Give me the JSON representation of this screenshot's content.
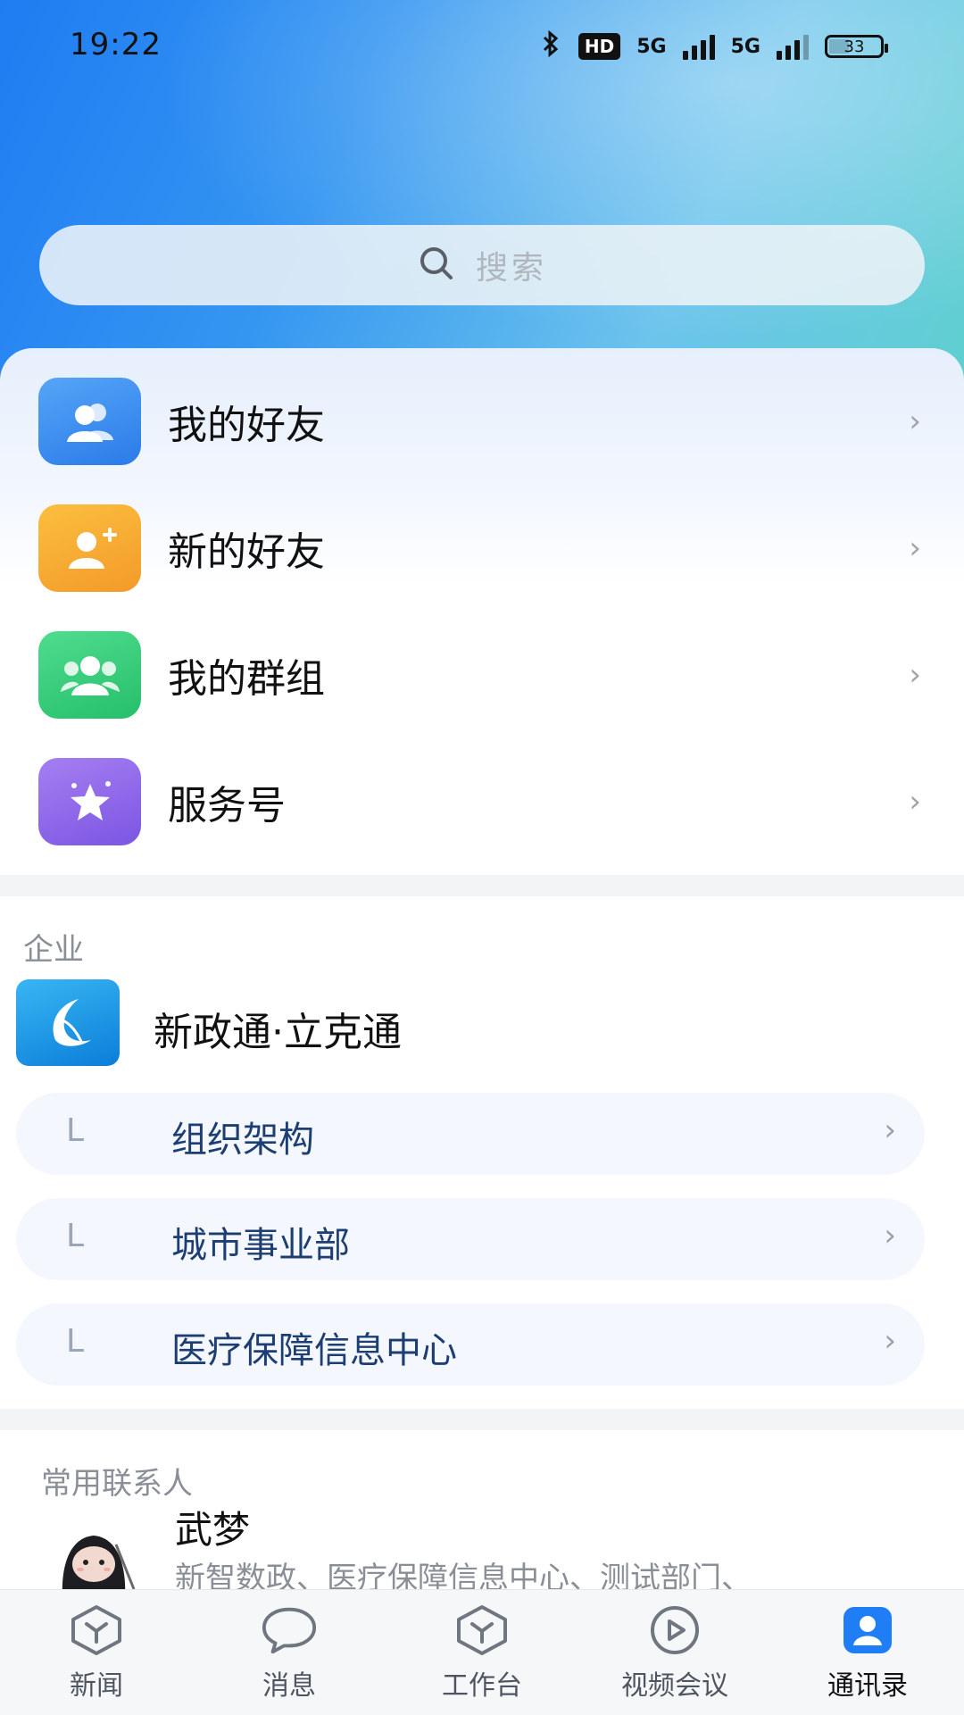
{
  "status_bar": {
    "time": "19:22",
    "hd_label": "HD",
    "network_1": "5G",
    "network_2": "5G",
    "battery": "33"
  },
  "search": {
    "placeholder": "搜索"
  },
  "menu": [
    {
      "label": "我的好友",
      "icon": "friends-icon",
      "color": "#3a8ef3"
    },
    {
      "label": "新的好友",
      "icon": "add-friend-icon",
      "color": "#f4a733"
    },
    {
      "label": "我的群组",
      "icon": "group-icon",
      "color": "#3ccf7d"
    },
    {
      "label": "服务号",
      "icon": "star-service-icon",
      "color": "#9167ea"
    }
  ],
  "enterprise": {
    "section_title": "企业",
    "company_name": "新政通·立克通",
    "org_items": [
      {
        "prefix": "L",
        "label": "组织架构"
      },
      {
        "prefix": "L",
        "label": "城市事业部"
      },
      {
        "prefix": "L",
        "label": "医疗保障信息中心"
      }
    ]
  },
  "frequent_contacts": {
    "section_title": "常用联系人",
    "items": [
      {
        "name": "武梦",
        "departments": "新智数政、医疗保障信息中心、测试部门、"
      }
    ]
  },
  "tabbar": {
    "items": [
      {
        "label": "新闻",
        "icon": "news-icon",
        "active": false
      },
      {
        "label": "消息",
        "icon": "message-icon",
        "active": false
      },
      {
        "label": "工作台",
        "icon": "workbench-icon",
        "active": false
      },
      {
        "label": "视频会议",
        "icon": "video-meeting-icon",
        "active": false
      },
      {
        "label": "通讯录",
        "icon": "contacts-icon",
        "active": true
      }
    ],
    "active_color": "#1f7ef5"
  }
}
